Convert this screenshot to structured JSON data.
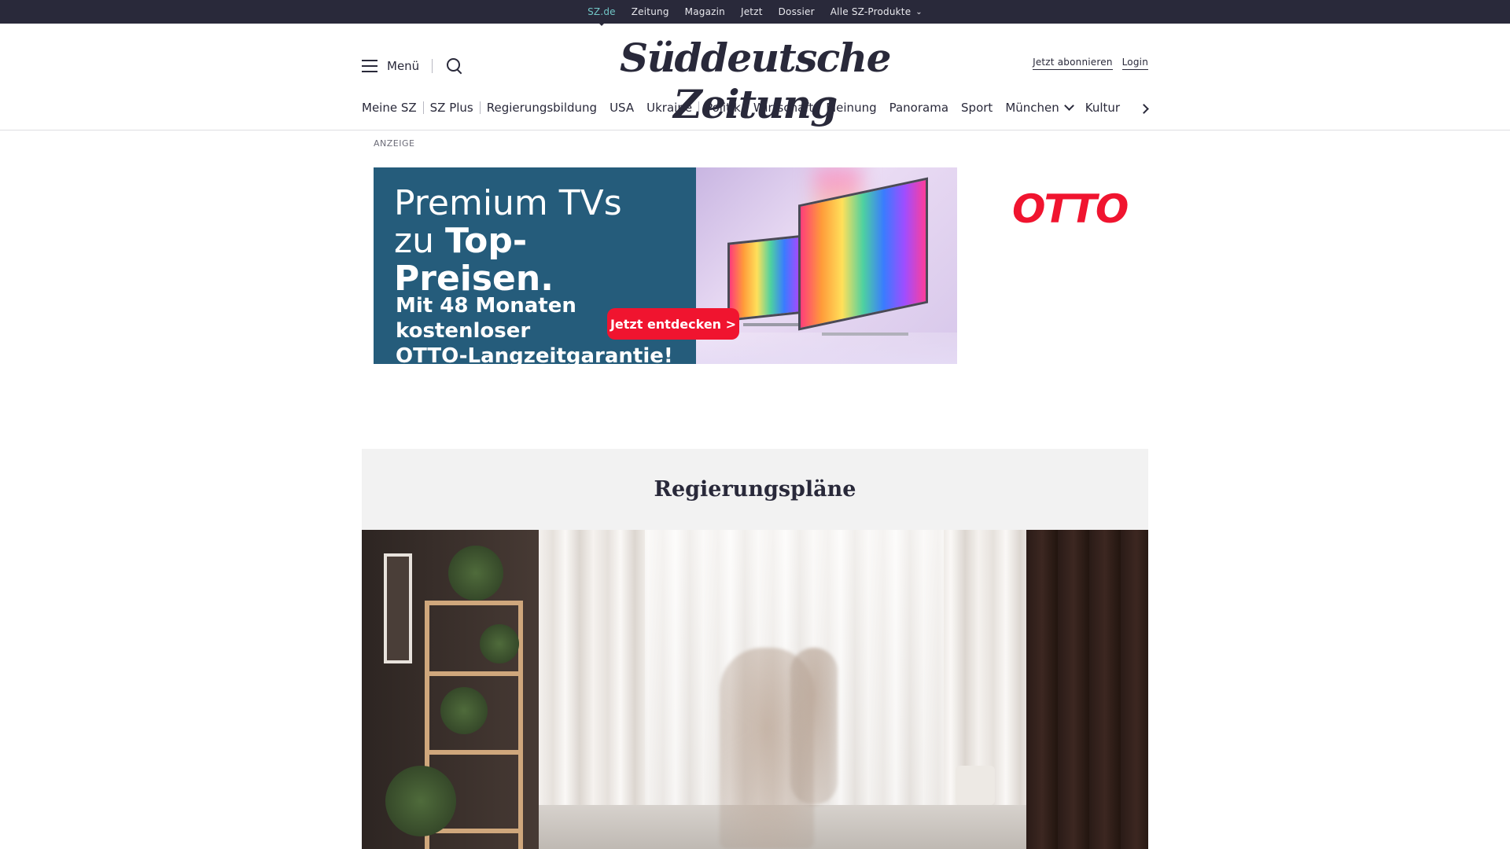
{
  "topbar": {
    "links": [
      "SZ.de",
      "Zeitung",
      "Magazin",
      "Jetzt",
      "Dossier",
      "Alle SZ-Produkte"
    ]
  },
  "header": {
    "menu_label": "Menü",
    "logo": "Süddeutsche Zeitung",
    "subscribe": "Jetzt abonnieren",
    "login": "Login"
  },
  "nav": {
    "items": [
      "Meine SZ",
      "SZ Plus",
      "Regierungsbildung",
      "USA",
      "Ukraine",
      "Politik",
      "Wirtschaft",
      "Meinung",
      "Panorama",
      "Sport",
      "München",
      "Kultur"
    ]
  },
  "ad": {
    "label": "ANZEIGE",
    "headline_line1": "Premium TVs",
    "headline_line2_prefix": "zu ",
    "headline_line2_bold": "Top-Preisen.",
    "sub_line1": "Mit 48 Monaten kostenloser",
    "sub_line2": "OTTO-Langzeitgarantie!",
    "brand": "OTTO",
    "cta": "Jetzt entdecken >",
    "accent_color": "#f0142f",
    "panel_color": "#255c7b"
  },
  "section": {
    "title": "Regierungspläne"
  },
  "icons": {
    "menu": "hamburger-icon",
    "search": "search-icon",
    "more": "chevron-right-icon",
    "dropdown": "chevron-down-icon"
  }
}
